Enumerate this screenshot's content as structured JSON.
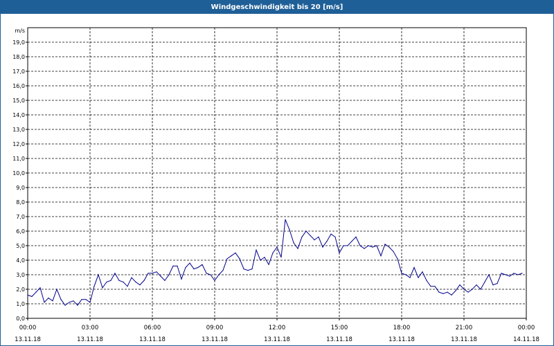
{
  "title": "Windgeschwindigkeit bis 20 [m/s]",
  "chart_data": {
    "type": "line",
    "title": "Windgeschwindigkeit bis 20 [m/s]",
    "ylabel": "m/s",
    "ylim": [
      0,
      20
    ],
    "yticks": [
      "0,0",
      "1,0",
      "2,0",
      "3,0",
      "4,0",
      "5,0",
      "6,0",
      "7,0",
      "8,0",
      "9,0",
      "10,0",
      "11,0",
      "12,0",
      "13,0",
      "14,0",
      "15,0",
      "16,0",
      "17,0",
      "18,0",
      "19,0"
    ],
    "xlim": [
      0,
      24
    ],
    "xunit": "hours since 13.11.18 00:00",
    "xticks": [
      {
        "h": 0,
        "time": "00:00",
        "date": "13.11.18"
      },
      {
        "h": 3,
        "time": "03:00",
        "date": "13.11.18"
      },
      {
        "h": 6,
        "time": "06:00",
        "date": "13.11.18"
      },
      {
        "h": 9,
        "time": "09:00",
        "date": "13.11.18"
      },
      {
        "h": 12,
        "time": "12:00",
        "date": "13.11.18"
      },
      {
        "h": 15,
        "time": "15:00",
        "date": "13.11.18"
      },
      {
        "h": 18,
        "time": "18:00",
        "date": "13.11.18"
      },
      {
        "h": 21,
        "time": "21:00",
        "date": "13.11.18"
      },
      {
        "h": 24,
        "time": "00:00",
        "date": "14.11.18"
      }
    ],
    "grid": true,
    "line_color": "#00008b",
    "series": [
      {
        "x": [
          0,
          0.2,
          0.4,
          0.6,
          0.8,
          1.0,
          1.2,
          1.4,
          1.6,
          1.8,
          2.0,
          2.2,
          2.4,
          2.6,
          2.8,
          3.0,
          3.2,
          3.4,
          3.6,
          3.8,
          4.0,
          4.2,
          4.4,
          4.6,
          4.8,
          5.0,
          5.2,
          5.4,
          5.6,
          5.8,
          6.0,
          6.2,
          6.4,
          6.6,
          6.8,
          7.0,
          7.2,
          7.4,
          7.6,
          7.8,
          8.0,
          8.2,
          8.4,
          8.6,
          8.8,
          9.0,
          9.2,
          9.4,
          9.6,
          9.8,
          10.0,
          10.2,
          10.4,
          10.6,
          10.8,
          11.0,
          11.2,
          11.4,
          11.6,
          11.8,
          12.0,
          12.2,
          12.4,
          12.6,
          12.8,
          13.0,
          13.2,
          13.4,
          13.6,
          13.8,
          14.0,
          14.2,
          14.4,
          14.6,
          14.8,
          15.0,
          15.2,
          15.4,
          15.6,
          15.8,
          16.0,
          16.2,
          16.4,
          16.6,
          16.8,
          17.0,
          17.2,
          17.4,
          17.6,
          17.8,
          18.0,
          18.2,
          18.4,
          18.6,
          18.8,
          19.0,
          19.2,
          19.4,
          19.6,
          19.8,
          20.0,
          20.2,
          20.4,
          20.6,
          20.8,
          21.0,
          21.2,
          21.4,
          21.6,
          21.8,
          22.0,
          22.2,
          22.4,
          22.6,
          22.8,
          23.0,
          23.2,
          23.4,
          23.6,
          23.8
        ],
        "values": [
          1.6,
          1.5,
          1.8,
          2.1,
          1.1,
          1.4,
          1.2,
          2.0,
          1.3,
          0.9,
          1.1,
          1.2,
          0.9,
          1.3,
          1.3,
          1.1,
          2.2,
          3.0,
          2.1,
          2.5,
          2.6,
          3.1,
          2.6,
          2.5,
          2.2,
          2.8,
          2.5,
          2.3,
          2.6,
          3.1,
          3.1,
          3.2,
          2.9,
          2.6,
          3.0,
          3.6,
          3.6,
          2.7,
          3.5,
          3.8,
          3.4,
          3.5,
          3.7,
          3.1,
          3.0,
          2.6,
          3.0,
          3.3,
          4.1,
          4.3,
          4.5,
          4.1,
          3.4,
          3.3,
          3.4,
          4.7,
          4.0,
          4.2,
          3.7,
          4.5,
          4.9,
          4.2,
          6.8,
          6.1,
          5.2,
          4.8,
          5.6,
          6.0,
          5.7,
          5.4,
          5.6,
          4.9,
          5.3,
          5.8,
          5.6,
          4.5,
          5.0,
          5.0,
          5.3,
          5.6,
          5.0,
          4.8,
          5.0,
          4.9,
          5.0,
          4.3,
          5.1,
          4.9,
          4.6,
          4.1,
          3.1,
          3.0,
          2.8,
          3.5,
          2.8,
          3.2,
          2.6,
          2.2,
          2.2,
          1.8,
          1.7,
          1.8,
          1.6,
          1.9,
          2.3,
          2.0,
          1.8,
          2.0,
          2.3,
          2.0,
          2.5,
          3.0,
          2.3,
          2.4,
          3.1,
          3.0,
          2.9,
          3.1,
          3.0,
          3.1
        ]
      }
    ]
  }
}
